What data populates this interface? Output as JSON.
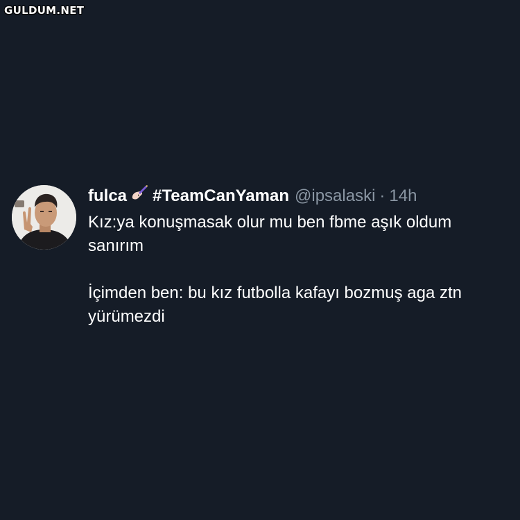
{
  "watermark": "GULDUM.NET",
  "tweet": {
    "display_name": "fulca",
    "emoji": "writing-hand",
    "name_suffix": "#TeamCanYaman",
    "handle": "@ipsalaski",
    "separator": "·",
    "time": "14h",
    "paragraphs": [
      "Kız:ya konuşmasak olur mu ben fbme aşık oldum sanırım",
      "İçimden ben: bu kız futbolla kafayı bozmuş aga ztn yürümezdi"
    ]
  },
  "colors": {
    "background": "#151c27",
    "text": "#ffffff",
    "muted": "#8a96a3"
  }
}
